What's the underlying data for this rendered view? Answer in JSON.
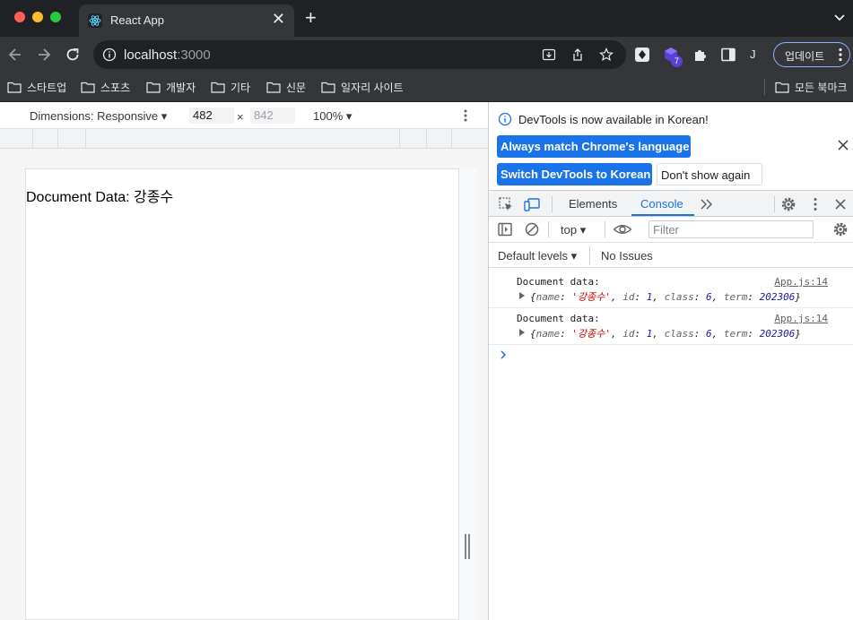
{
  "browser": {
    "tab": {
      "title": "React App",
      "close_glyph": "✕"
    },
    "new_tab_glyph": "+",
    "address": {
      "host": "localhost",
      "port": ":3000"
    },
    "extensions_badge": "7",
    "profile_initial": "J",
    "update_label": "업데이트"
  },
  "bookmarks": {
    "items": [
      {
        "label": "스타트업"
      },
      {
        "label": "스포츠"
      },
      {
        "label": "개발자"
      },
      {
        "label": "기타"
      },
      {
        "label": "신문"
      },
      {
        "label": "일자리 사이트"
      }
    ],
    "other": "모든 북마크"
  },
  "device_toolbar": {
    "dimensions_label": "Dimensions: Responsive",
    "width": "482",
    "height": "842",
    "times": "×",
    "zoom": "100%"
  },
  "page": {
    "text": "Document Data: 강종수"
  },
  "devtools": {
    "infobar": {
      "message": "DevTools is now available in Korean!",
      "always_match": "Always match Chrome's language",
      "switch": "Switch DevTools to Korean",
      "dont_show": "Don't show again"
    },
    "tabs": {
      "elements": "Elements",
      "console": "Console"
    },
    "context": "top",
    "filter_placeholder": "Filter",
    "levels": "Default levels",
    "issues": "No Issues",
    "logs": [
      {
        "message": "Document data:",
        "source": "App.js:14",
        "object": {
          "name": "'강종수'",
          "id": "1",
          "class": "6",
          "term": "202306"
        }
      },
      {
        "message": "Document data:",
        "source": "App.js:14",
        "object": {
          "name": "'강종수'",
          "id": "1",
          "class": "6",
          "term": "202306"
        }
      }
    ]
  },
  "colors": {
    "chrome_dark": "#202124",
    "chrome_toolbar": "#35363a",
    "accent_blue": "#1a73e8"
  }
}
